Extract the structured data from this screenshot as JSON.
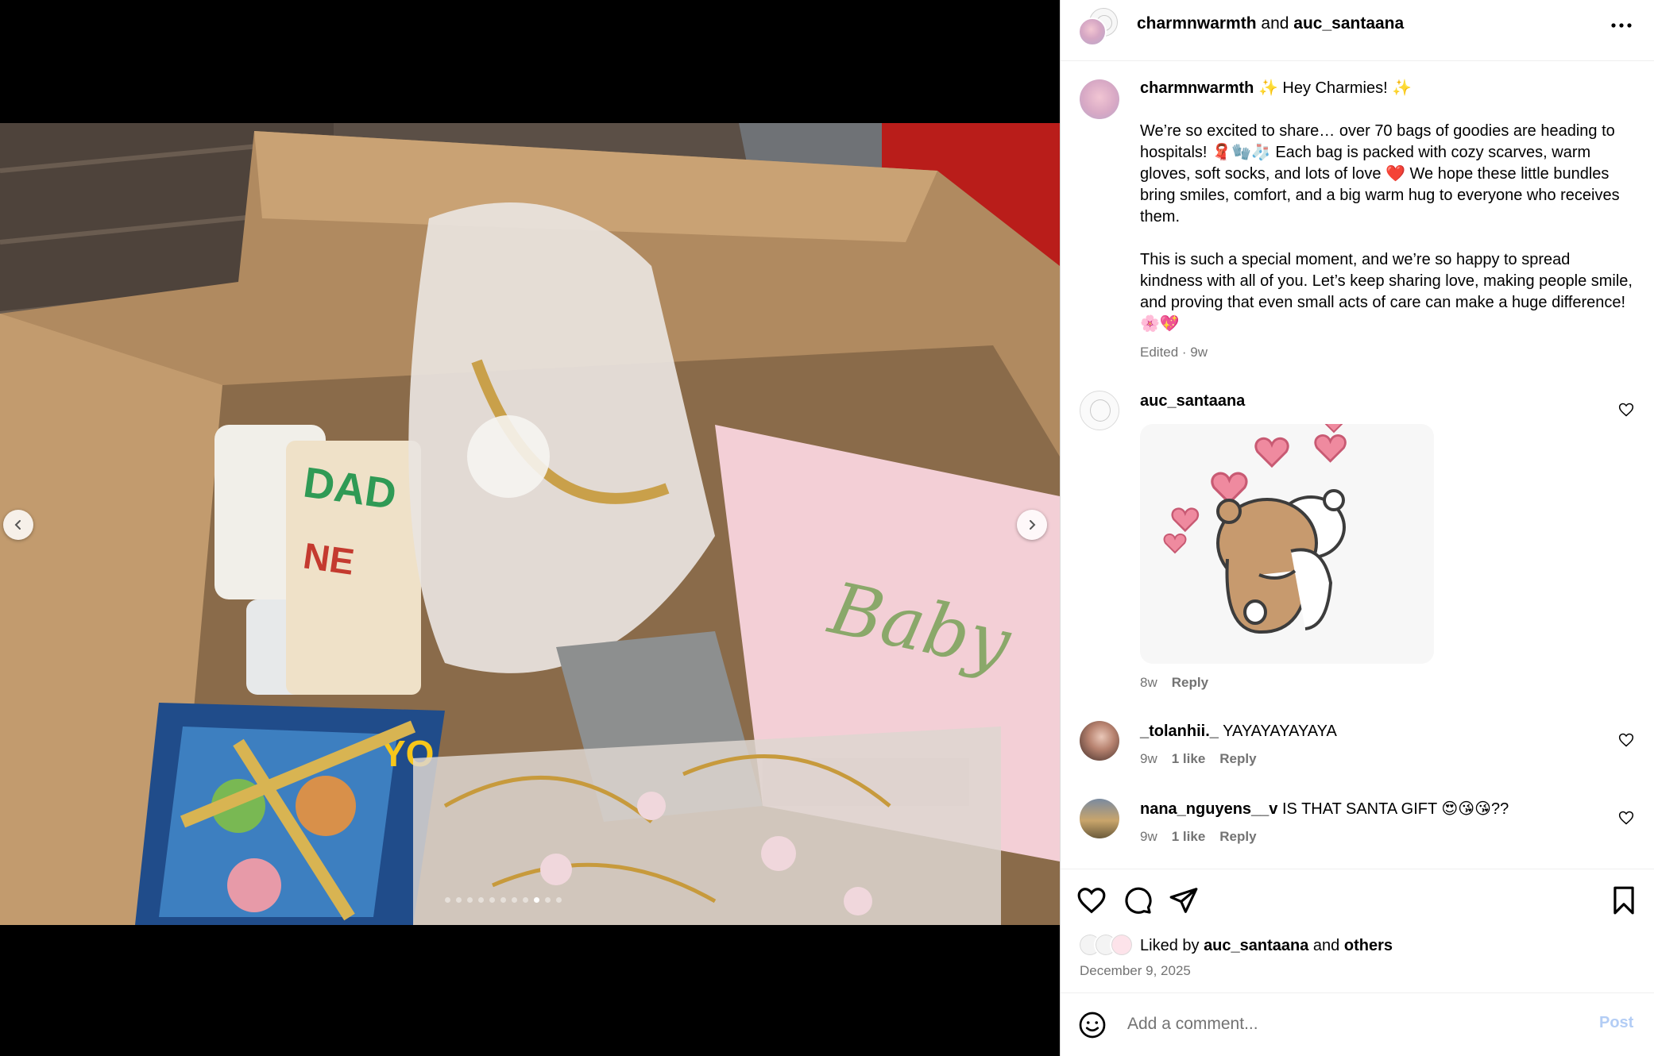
{
  "post": {
    "header": {
      "author": "charmnwarmth",
      "connector": "and",
      "collaborator": "auc_santaana"
    },
    "caption": {
      "user": "charmnwarmth",
      "intro": "✨ Hey Charmies! ✨",
      "paragraph1": "We’re so excited to share… over 70 bags of goodies are heading to hospitals! 🧣🧤🧦 Each bag is packed with cozy scarves, warm gloves, soft socks, and lots of love ❤️ We hope these little bundles bring smiles, comfort, and a big warm hug to everyone who receives them.",
      "paragraph2": "This is such a special moment, and we’re so happy to spread kindness with all of you. Let’s keep sharing love, making people smile, and proving that even small acts of care can make a huge difference! 🌸💖",
      "meta": "Edited · 9w"
    },
    "comments": [
      {
        "user": "auc_santaana",
        "text": "",
        "time": "8w",
        "likes": "",
        "reply": "Reply",
        "sticker": "bear-hug-sticker"
      },
      {
        "user": "_tolanhii._",
        "text": "YAYAYAYAYAYA",
        "time": "9w",
        "likes": "1 like",
        "reply": "Reply"
      },
      {
        "user": "nana_nguyens__v",
        "text": "IS THAT SANTA GIFT 😍😘😘??",
        "time": "9w",
        "likes": "1 like",
        "reply": "Reply"
      }
    ],
    "liked_by": {
      "prefix": "Liked by",
      "user": "auc_santaana",
      "connector": "and",
      "others": "others"
    },
    "date": "December 9, 2025",
    "composer": {
      "placeholder": "Add a comment...",
      "post_label": "Post"
    },
    "carousel": {
      "slides": 11,
      "active_index": 8
    }
  },
  "icons": {
    "more": "more-horizontal-icon",
    "like": "heart-icon",
    "comment": "comment-bubble-icon",
    "share": "paper-plane-icon",
    "save": "bookmark-icon",
    "emoji": "smiley-icon",
    "prev": "chevron-left-icon",
    "next": "chevron-right-icon"
  },
  "colors": {
    "secondary_text": "#737373",
    "post_button_disabled": "#b3cdf5",
    "divider": "#efefef"
  }
}
